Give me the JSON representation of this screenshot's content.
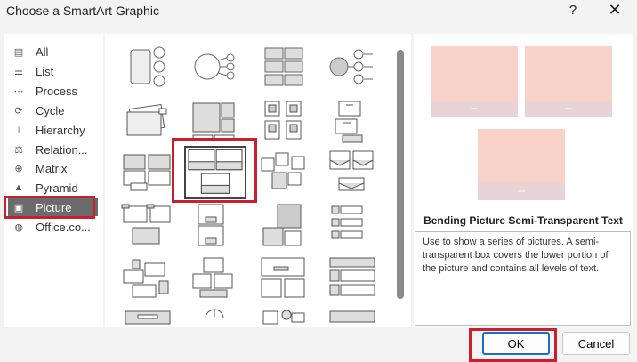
{
  "window": {
    "title": "Choose a SmartArt Graphic",
    "help_glyph": "?",
    "close_glyph": "✕"
  },
  "categories": [
    {
      "label": "All",
      "icon": "all-icon",
      "glyph": "▤"
    },
    {
      "label": "List",
      "icon": "list-icon",
      "glyph": "☰"
    },
    {
      "label": "Process",
      "icon": "process-icon",
      "glyph": "⋯"
    },
    {
      "label": "Cycle",
      "icon": "cycle-icon",
      "glyph": "⟳"
    },
    {
      "label": "Hierarchy",
      "icon": "hierarchy-icon",
      "glyph": "⊥"
    },
    {
      "label": "Relation...",
      "icon": "relationship-icon",
      "glyph": "⚖"
    },
    {
      "label": "Matrix",
      "icon": "matrix-icon",
      "glyph": "⊕"
    },
    {
      "label": "Pyramid",
      "icon": "pyramid-icon",
      "glyph": "▲"
    },
    {
      "label": "Picture",
      "icon": "picture-icon",
      "glyph": "▣"
    },
    {
      "label": "Office.co...",
      "icon": "globe-icon",
      "glyph": "◍"
    }
  ],
  "selected_category": "Picture",
  "preview": {
    "title": "Bending Picture Semi-Transparent Text",
    "description": "Use to show a series of pictures. A semi-transparent box covers the lower portion of the picture and contains all levels of text.",
    "accent_color": "#f8d2c8",
    "band_color": "#e8d3d6"
  },
  "buttons": {
    "ok": "OK",
    "cancel": "Cancel"
  },
  "colors": {
    "highlight": "#c8202f",
    "selected": "#6b6b6b",
    "primary_border": "#1c6ec5"
  }
}
